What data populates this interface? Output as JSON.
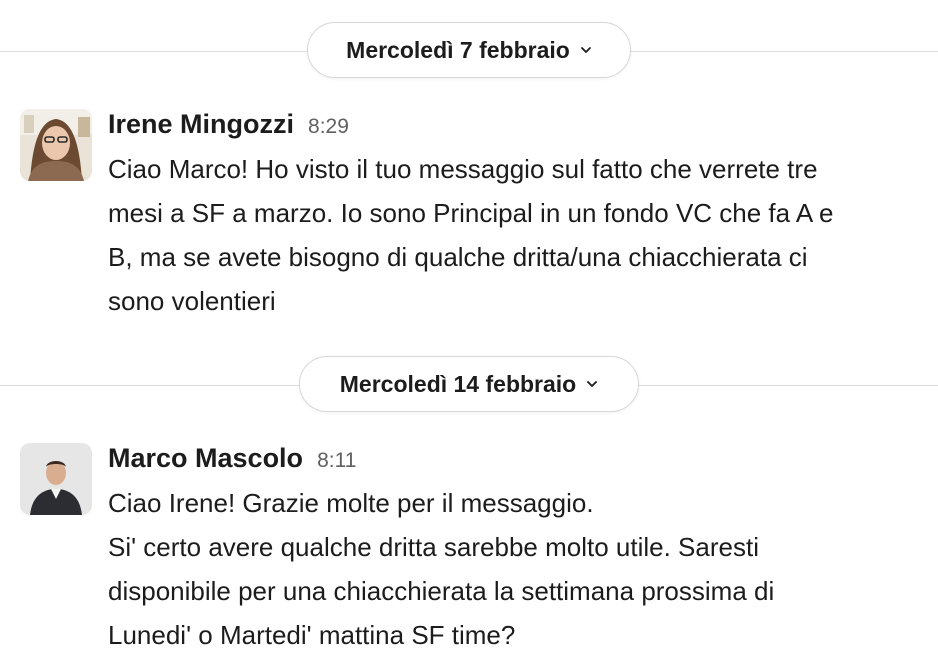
{
  "dividers": [
    {
      "label": "Mercoledì 7 febbraio"
    },
    {
      "label": "Mercoledì 14 febbraio"
    }
  ],
  "messages": [
    {
      "author": "Irene Mingozzi",
      "time": "8:29",
      "lines": [
        "Ciao Marco! Ho visto il tuo messaggio sul fatto che verrete tre",
        "mesi a SF a marzo. Io sono Principal in un fondo VC che fa A e",
        "B, ma se avete bisogno di qualche dritta/una chiacchierata ci",
        "sono volentieri"
      ]
    },
    {
      "author": "Marco Mascolo",
      "time": "8:11",
      "lines": [
        "Ciao Irene! Grazie molte per il messaggio.",
        "Si' certo avere qualche dritta sarebbe molto utile. Saresti",
        "disponibile per una chiacchierata la settimana prossima di",
        "Lunedi' o Martedi' mattina SF time?"
      ]
    }
  ],
  "icons": {
    "date_chevron": "chevron-down-icon",
    "avatar_1": "avatar",
    "avatar_2": "avatar"
  },
  "colors": {
    "text": "#1d1c1d",
    "muted": "#616061",
    "divider": "#dddddd"
  }
}
